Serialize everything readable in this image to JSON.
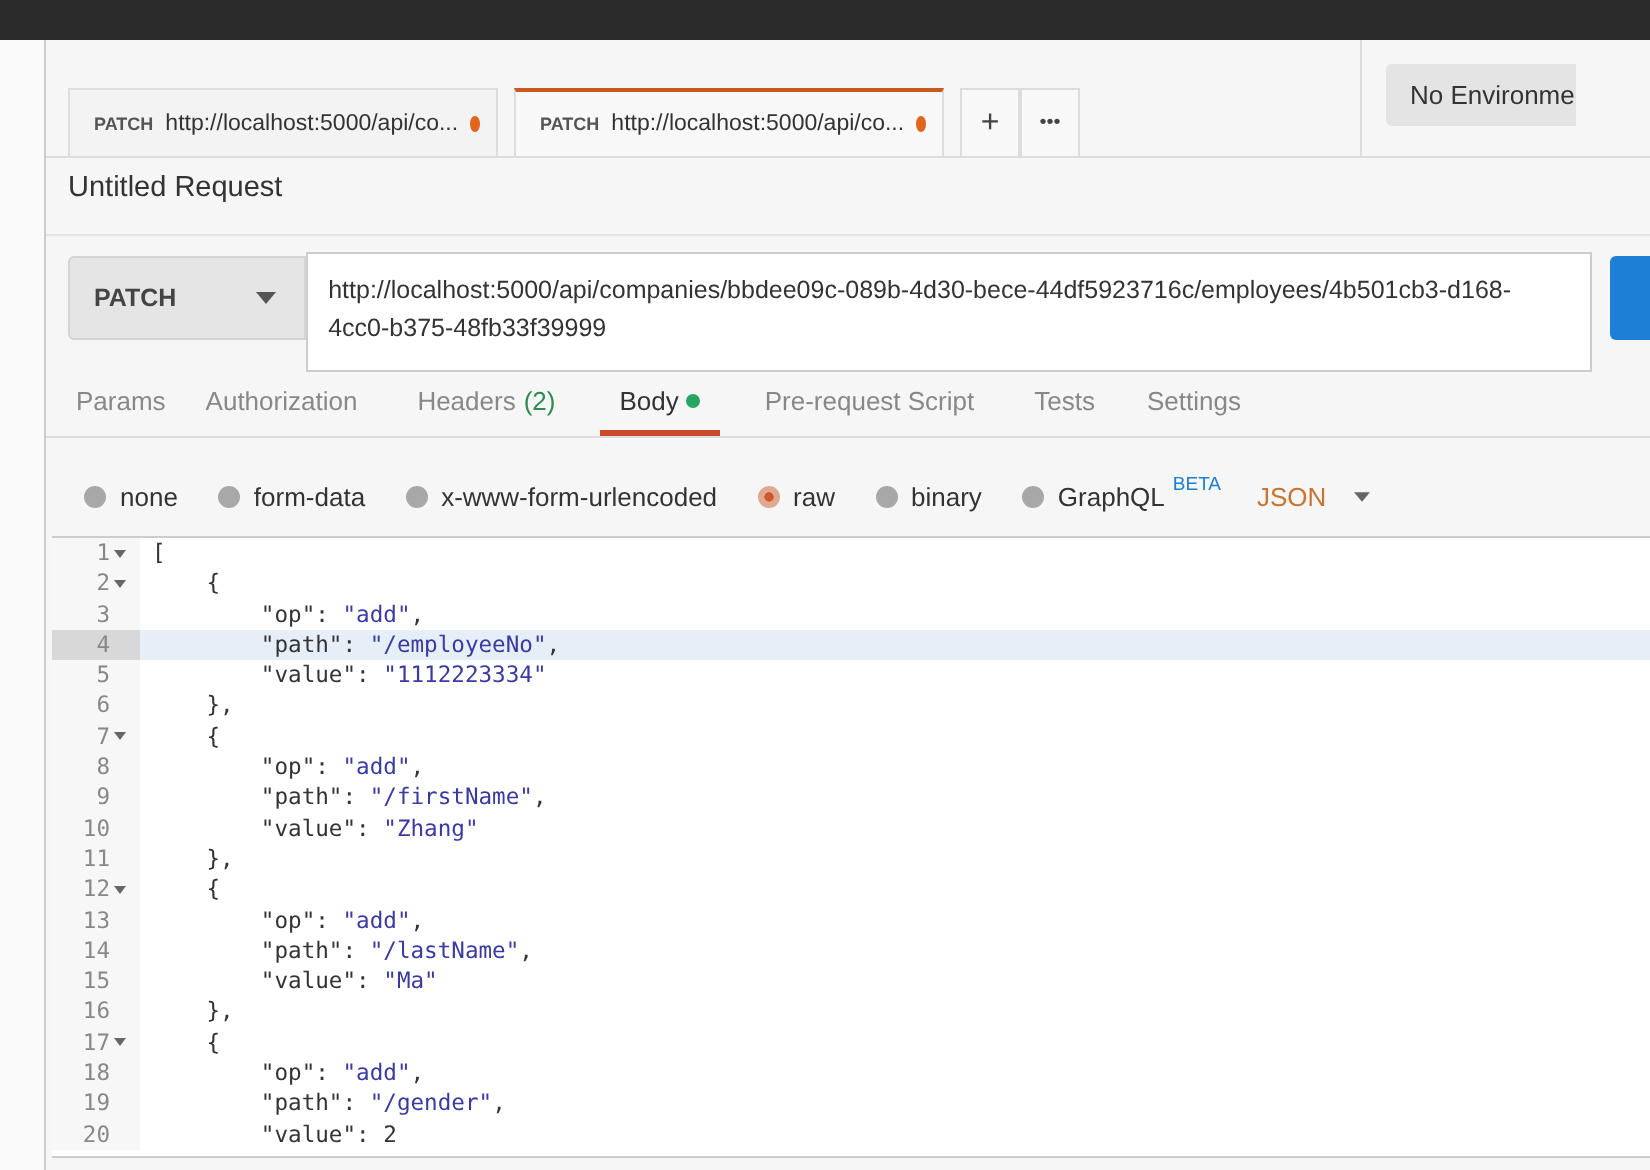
{
  "request_tabs": [
    {
      "method": "PATCH",
      "url": "http://localhost:5000/api/co...",
      "unsaved": true,
      "selected": false
    },
    {
      "method": "PATCH",
      "url": "http://localhost:5000/api/co...",
      "unsaved": true,
      "selected": true
    }
  ],
  "new_tab": "+",
  "more_tabs": "•••",
  "environment": "No Environme",
  "request_title": "Untitled Request",
  "method": "PATCH",
  "url": "http://localhost:5000/api/companies/bbdee09c-089b-4d30-bece-44df5923716c/employees/4b501cb3-d168-4cc0-b375-48fb33f39999",
  "sub_tabs": [
    {
      "label": "Params",
      "dot": false,
      "selected": false
    },
    {
      "label": "Authorization",
      "dot": false,
      "selected": false
    },
    {
      "label": "Headers",
      "count": "(2)",
      "dot": false,
      "selected": false
    },
    {
      "label": "Body",
      "dot": true,
      "selected": true
    },
    {
      "label": "Pre-request Script",
      "dot": false,
      "selected": false
    },
    {
      "label": "Tests",
      "dot": false,
      "selected": false
    },
    {
      "label": "Settings",
      "dot": false,
      "selected": false
    }
  ],
  "body_types": [
    {
      "label": "none",
      "selected": false
    },
    {
      "label": "form-data",
      "selected": false
    },
    {
      "label": "x-www-form-urlencoded",
      "selected": false
    },
    {
      "label": "raw",
      "selected": true
    },
    {
      "label": "binary",
      "selected": false
    },
    {
      "label": "GraphQL",
      "badge": "BETA",
      "selected": false
    }
  ],
  "format": "JSON",
  "code_lines": [
    {
      "number": "1",
      "text": "[",
      "foldable": true,
      "current": false
    },
    {
      "number": "2",
      "text": "    {",
      "foldable": true,
      "current": false
    },
    {
      "number": "3",
      "text": "        \"op\": \"add\",",
      "foldable": false,
      "current": false
    },
    {
      "number": "4",
      "text": "        \"path\": \"/employeeNo\",",
      "foldable": false,
      "current": true
    },
    {
      "number": "5",
      "text": "        \"value\": \"1112223334\"",
      "foldable": false,
      "current": false
    },
    {
      "number": "6",
      "text": "    },",
      "foldable": false,
      "current": false
    },
    {
      "number": "7",
      "text": "    {",
      "foldable": true,
      "current": false
    },
    {
      "number": "8",
      "text": "        \"op\": \"add\",",
      "foldable": false,
      "current": false
    },
    {
      "number": "9",
      "text": "        \"path\": \"/firstName\",",
      "foldable": false,
      "current": false
    },
    {
      "number": "10",
      "text": "        \"value\": \"Zhang\"",
      "foldable": false,
      "current": false
    },
    {
      "number": "11",
      "text": "    },",
      "foldable": false,
      "current": false
    },
    {
      "number": "12",
      "text": "    {",
      "foldable": true,
      "current": false
    },
    {
      "number": "13",
      "text": "        \"op\": \"add\",",
      "foldable": false,
      "current": false
    },
    {
      "number": "14",
      "text": "        \"path\": \"/lastName\",",
      "foldable": false,
      "current": false
    },
    {
      "number": "15",
      "text": "        \"value\": \"Ma\"",
      "foldable": false,
      "current": false
    },
    {
      "number": "16",
      "text": "    },",
      "foldable": false,
      "current": false
    },
    {
      "number": "17",
      "text": "    {",
      "foldable": true,
      "current": false
    },
    {
      "number": "18",
      "text": "        \"op\": \"add\",",
      "foldable": false,
      "current": false
    },
    {
      "number": "19",
      "text": "        \"path\": \"/gender\",",
      "foldable": false,
      "current": false
    },
    {
      "number": "20",
      "text": "        \"value\": 2",
      "foldable": false,
      "current": false
    }
  ]
}
